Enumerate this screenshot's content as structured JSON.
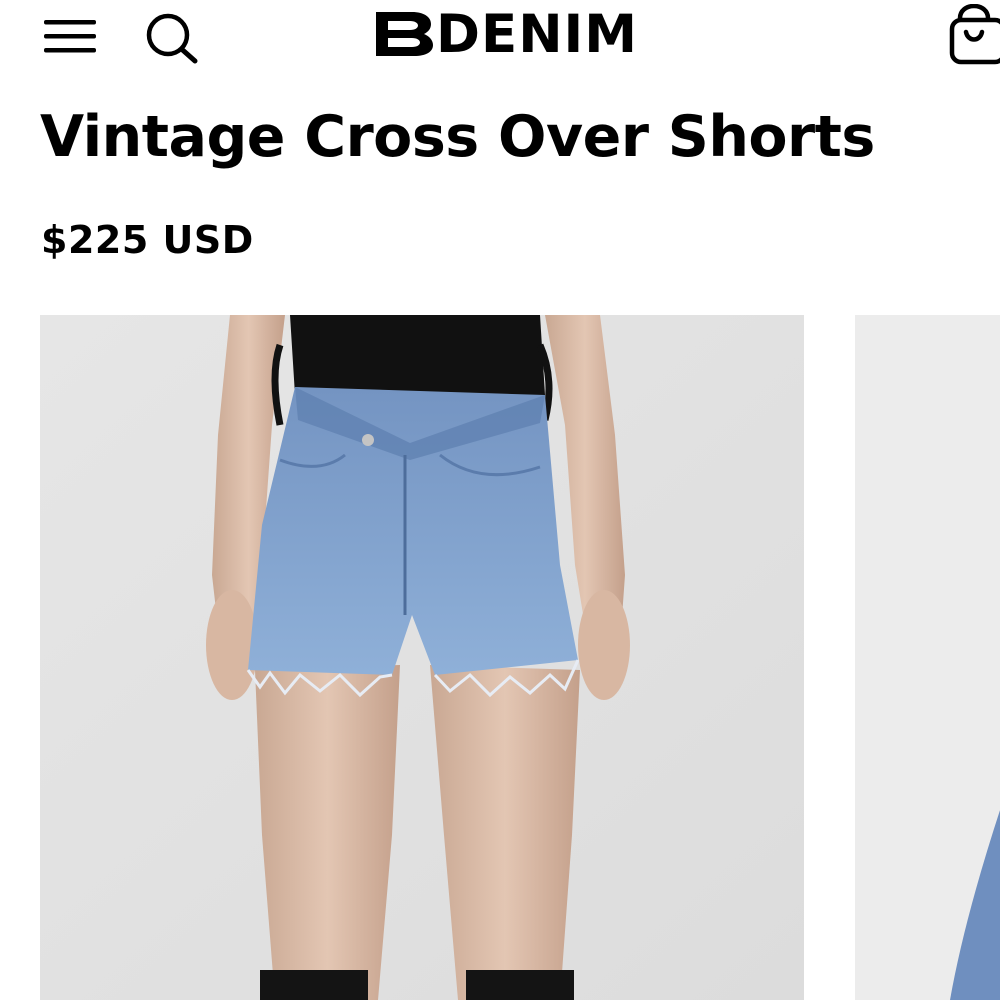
{
  "header": {
    "brand_name": "DENIM",
    "menu_icon": "hamburger-menu-icon",
    "search_icon": "search-icon",
    "cart_icon": "shopping-bag-icon"
  },
  "product": {
    "title": "Vintage Cross Over Shorts",
    "price": "$225 USD"
  },
  "gallery": {
    "images": [
      "product-photo-front-view",
      "product-photo-next-view"
    ]
  },
  "colors": {
    "text": "#000000",
    "background": "#ffffff",
    "photo_background": "#e8e8e8",
    "denim": "#7a9dcb"
  }
}
